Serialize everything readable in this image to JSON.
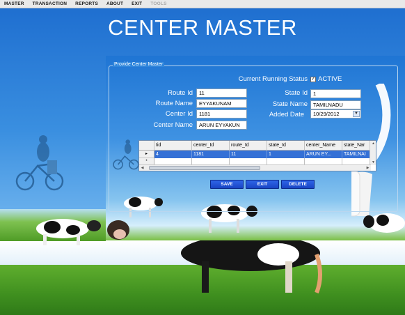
{
  "menu": {
    "items": [
      {
        "label": "MASTER",
        "enabled": true
      },
      {
        "label": "TRANSACTION",
        "enabled": true
      },
      {
        "label": "REPORTS",
        "enabled": true
      },
      {
        "label": "ABOUT",
        "enabled": true
      },
      {
        "label": "EXIT",
        "enabled": true
      },
      {
        "label": "TOOLS",
        "enabled": false
      }
    ]
  },
  "page": {
    "title": "CENTER MASTER"
  },
  "form": {
    "group_title": "Provide Center Master",
    "status_label": "Current Running Status",
    "status_value": "ACTIVE",
    "status_checked": true,
    "route_id_label": "Route Id",
    "route_id_value": "11",
    "route_name_label": "Route Name",
    "route_name_value": "EYYAKUNAM",
    "center_id_label": "Center Id",
    "center_id_value": "1181",
    "center_name_label": "Center Name",
    "center_name_value": "ARUN  EYYAKUN",
    "state_id_label": "State Id",
    "state_id_value": "1",
    "state_name_label": "State Name",
    "state_name_value": "TAMILNADU",
    "added_date_label": "Added Date",
    "added_date_value": "10/29/2012"
  },
  "grid": {
    "columns": [
      "tid",
      "center_Id",
      "route_Id",
      "state_Id",
      "center_Name",
      "state_Nar"
    ],
    "rows": [
      [
        "4",
        "1181",
        "11",
        "1",
        "ARUN  EY...",
        "TAMILNAI"
      ]
    ],
    "new_row_marker": "*",
    "current_row_marker": "▸"
  },
  "buttons": {
    "save": "SAVE",
    "exit": "EXIT",
    "delete": "DELETE"
  },
  "colors": {
    "button_blue": "#1f55d8",
    "selection_blue": "#3470d6",
    "background_blue": "#2d7fd0"
  },
  "icons": {
    "checkbox": "check-icon",
    "date_dropdown": "chevron-down-icon"
  }
}
